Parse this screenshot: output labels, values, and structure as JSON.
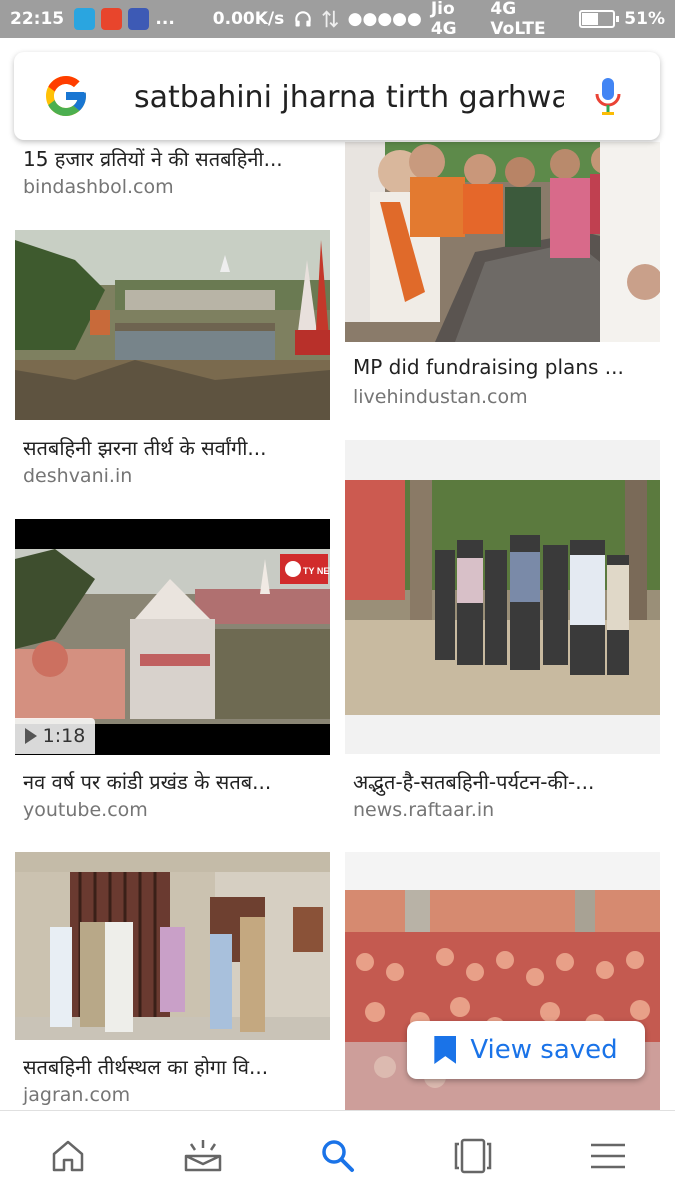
{
  "status_bar": {
    "time": "22:15",
    "dots": "...",
    "speed": "0.00K/s",
    "signal": "●●●●●",
    "carrier": "Jio 4G",
    "network": "4G VoLTE",
    "battery_percent": "51%",
    "battery_level": 0.51
  },
  "search": {
    "query": "satbahini jharna tirth garhwa",
    "mic_icon": "mic-icon",
    "logo": "google-g-logo"
  },
  "results": [
    {
      "caption": "15 हजार व्रतियों ने की सतबहिनी...",
      "source": "bindashbol.com"
    },
    {
      "caption": "MP did fundraising plans ...",
      "source": "livehindustan.com"
    },
    {
      "caption": "सतबहिनी झरना तीर्थ के सर्वांगी...",
      "source": "deshvani.in"
    },
    {
      "caption": "नव वर्ष पर कांडी प्रखंड के सतब...",
      "source": "youtube.com",
      "duration": "1:18",
      "channel_badge": "CITY NEWS"
    },
    {
      "caption": "अद्भुत-है-सतबहिनी-पर्यटन-की-...",
      "source": "news.raftaar.in"
    },
    {
      "caption": "सतबहिनी तीर्थस्थल का होगा वि...",
      "source": "jagran.com"
    },
    {
      "caption": "",
      "source": ""
    }
  ],
  "view_saved": {
    "label": "View saved",
    "icon": "bookmark-icon"
  },
  "bottom_nav": [
    {
      "name": "home",
      "icon": "home-icon"
    },
    {
      "name": "updates",
      "icon": "updates-icon"
    },
    {
      "name": "search",
      "icon": "search-icon",
      "active": true
    },
    {
      "name": "recent",
      "icon": "recent-tabs-icon"
    },
    {
      "name": "more",
      "icon": "menu-icon"
    }
  ],
  "colors": {
    "accent": "#1a73e8",
    "status_bar": "#9e9e9e"
  }
}
